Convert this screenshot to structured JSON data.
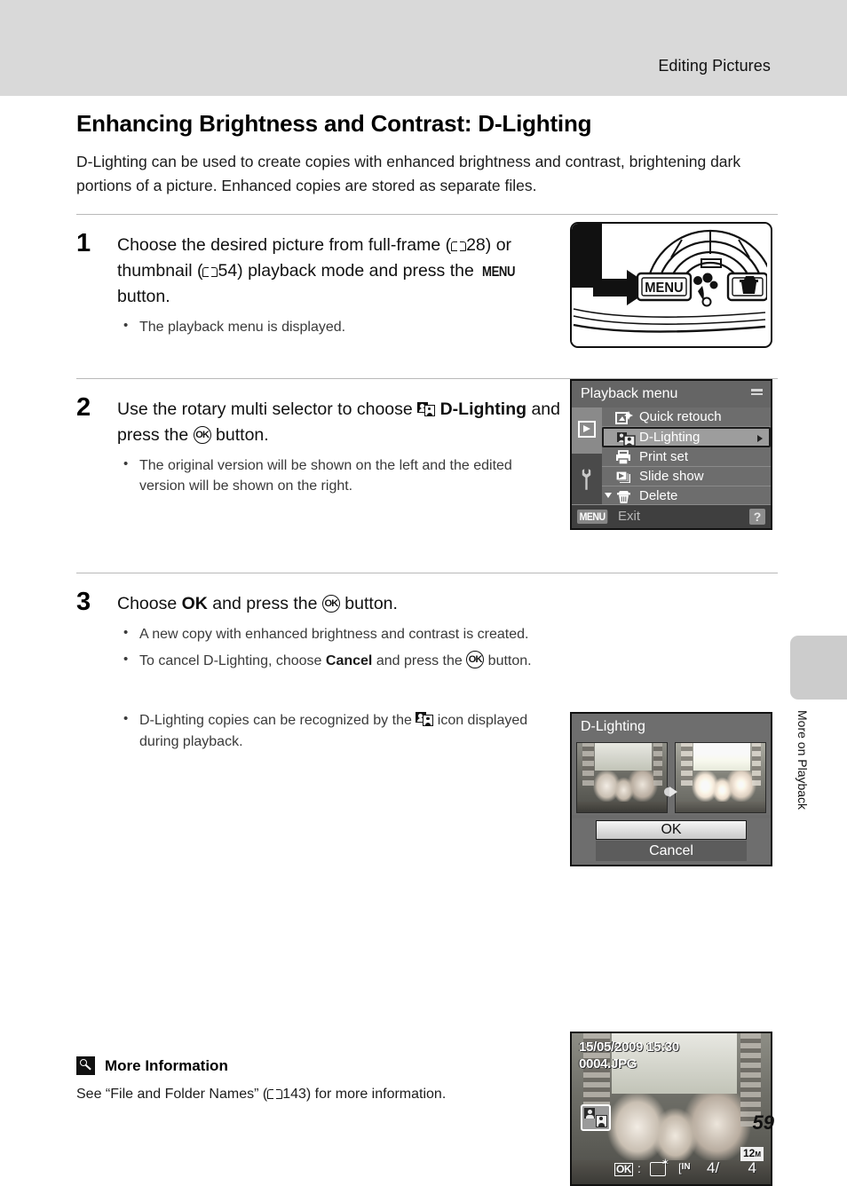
{
  "header": {
    "running_title": "Editing Pictures"
  },
  "section": {
    "title": "Enhancing Brightness and Contrast: D-Lighting",
    "intro": "D-Lighting can be used to create copies with enhanced brightness and contrast, brightening dark portions of a picture. Enhanced copies are stored as separate files."
  },
  "steps": [
    {
      "number": "1",
      "head_part1": "Choose the desired picture from full-frame (",
      "ref1": "28",
      "head_part2": ") or thumbnail (",
      "ref2": "54",
      "head_part3": ") playback mode and press the ",
      "menu_glyph": "MENU",
      "head_part4": " button.",
      "bullets": [
        "The playback menu is displayed."
      ]
    },
    {
      "number": "2",
      "head_part1": "Use the rotary multi selector to choose ",
      "head_bold": "D-Lighting",
      "head_part2": " and press the ",
      "ok_glyph": "OK",
      "head_part3": " button.",
      "bullets": [
        "The original version will be shown on the left and the edited version will be shown on the right."
      ]
    },
    {
      "number": "3",
      "head_part1": "Choose ",
      "head_bold1": "OK",
      "head_part2": " and press the ",
      "ok_glyph": "OK",
      "head_part3": " button.",
      "bullet1": "A new copy with enhanced brightness and contrast is created.",
      "bullet2_part1": "To cancel D-Lighting, choose ",
      "bullet2_bold": "Cancel",
      "bullet2_part2": " and press the ",
      "bullet2_part3": " button.",
      "bullet3_part1": "D-Lighting copies can be recognized by the ",
      "bullet3_part2": " icon displayed during playback."
    }
  ],
  "camera_figure": {
    "menu_button_label": "MENU",
    "macro_icon": "flower-macro-icon",
    "delete_icon": "trash-icon",
    "arrow": "right-arrow-pointer"
  },
  "playback_menu_screen": {
    "title": "Playback menu",
    "items": [
      {
        "label": "Quick retouch",
        "icon": "quick-retouch-icon",
        "selected": false
      },
      {
        "label": "D-Lighting",
        "icon": "d-lighting-icon",
        "selected": true
      },
      {
        "label": "Print set",
        "icon": "printer-icon",
        "selected": false
      },
      {
        "label": "Slide show",
        "icon": "slideshow-icon",
        "selected": false
      },
      {
        "label": "Delete",
        "icon": "trash-icon",
        "selected": false
      }
    ],
    "bottom_menu_badge": "MENU",
    "bottom_exit_label": "Exit",
    "help_badge": "?",
    "tabs": [
      "playback-tab",
      "setup-tab"
    ]
  },
  "dlighting_screen": {
    "title": "D-Lighting",
    "ok_label": "OK",
    "cancel_label": "Cancel",
    "ok_selected": true
  },
  "playback_screen": {
    "date": "15/05/2009 15:30",
    "filename": "0004.JPG",
    "dlighting_badge": "d-lighting-icon",
    "ok_badge": "OK",
    "separator": ":",
    "retouch_icon": "quick-retouch-icon",
    "memory": "IN",
    "frame_current": "4/",
    "frame_total": "4",
    "image_size": "12",
    "image_size_unit": "M"
  },
  "side_tab": {
    "label": "More on Playback"
  },
  "more_information": {
    "heading": "More Information",
    "text_part1": "See “File and Folder Names” (",
    "ref": "143",
    "text_part2": ") for more information."
  },
  "page_number": "59",
  "colors": {
    "header_band": "#d9d9d9",
    "side_tab": "#cccccc",
    "rule": "#b9b9b9",
    "lcd_bg": "#6b6b6b"
  }
}
